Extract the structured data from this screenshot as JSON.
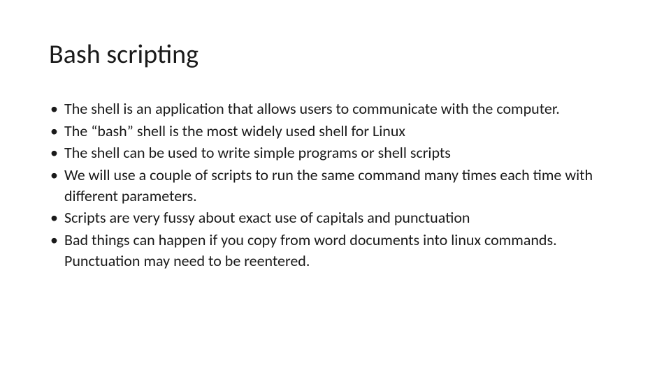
{
  "slide": {
    "title": "Bash scripting",
    "bullets": [
      "The shell is an application that allows users to communicate with the computer.",
      "The “bash” shell is the most widely used shell for Linux",
      "The shell can be used to write simple programs or shell scripts",
      "We will use a couple of scripts to run the same command many times each time with different parameters.",
      "Scripts are very fussy about exact use of capitals and punctuation",
      "Bad things can happen if you copy from word documents into linux commands. Punctuation may need to be reentered."
    ]
  }
}
